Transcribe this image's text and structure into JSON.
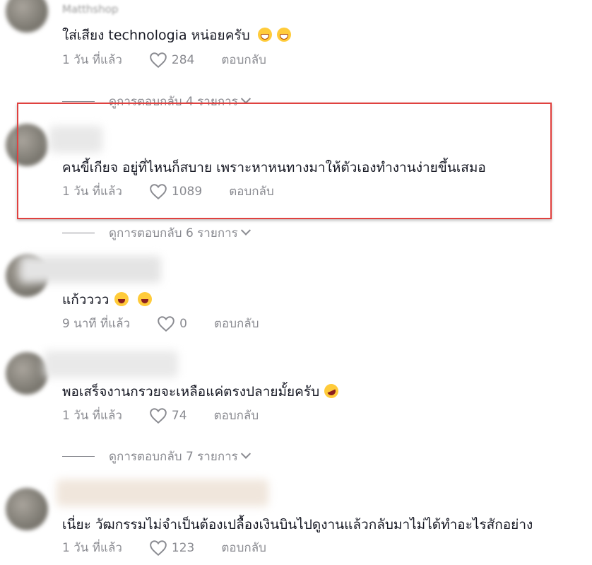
{
  "comments": [
    {
      "username": "Matthshop",
      "text": "ใส่เสียง technologia หน่อยครับ",
      "emojis": [
        "grinning-face-icon",
        "grinning-face-icon"
      ],
      "time": "1 วัน ที่แล้ว",
      "likes": "284",
      "reply_label": "ตอบกลับ",
      "view_replies": "ดูการตอบกลับ 4 รายการ"
    },
    {
      "text": "คนขี้เกียจ อยู่ที่ไหนก็สบาย เพราะหาหนทางมาให้ตัวเองทำงานง่ายขึ้นเสมอ",
      "time": "1 วัน ที่แล้ว",
      "likes": "1089",
      "reply_label": "ตอบกลับ",
      "view_replies": "ดูการตอบกลับ 6 รายการ",
      "highlighted": true,
      "highlight_color": "#e0413f"
    },
    {
      "text": "แก้วววว",
      "emojis": [
        "squinting-laughing-face-icon",
        "squinting-laughing-face-icon"
      ],
      "time": "9 นาที ที่แล้ว",
      "likes": "0",
      "reply_label": "ตอบกลับ"
    },
    {
      "text": "พอเสร็จงานกรวยจะเหลือแค่ตรงปลายมั้ยครับ",
      "emojis": [
        "rolling-on-floor-laughing-icon"
      ],
      "time": "1 วัน ที่แล้ว",
      "likes": "74",
      "reply_label": "ตอบกลับ",
      "view_replies": "ดูการตอบกลับ 7 รายการ"
    },
    {
      "text": "เนี่ยะ วัฒกรรมไม่จำเป็นต้องเปลื้องเงินบินไปดูงานแล้วกลับมาไม่ได้ทำอะไรสักอย่าง",
      "time": "1 วัน ที่แล้ว",
      "likes": "123",
      "reply_label": "ตอบกลับ"
    }
  ],
  "colors": {
    "text": "#161823",
    "meta": "#8a8b91",
    "highlight_border": "#e0413f",
    "emoji": "#ffcb3a"
  }
}
